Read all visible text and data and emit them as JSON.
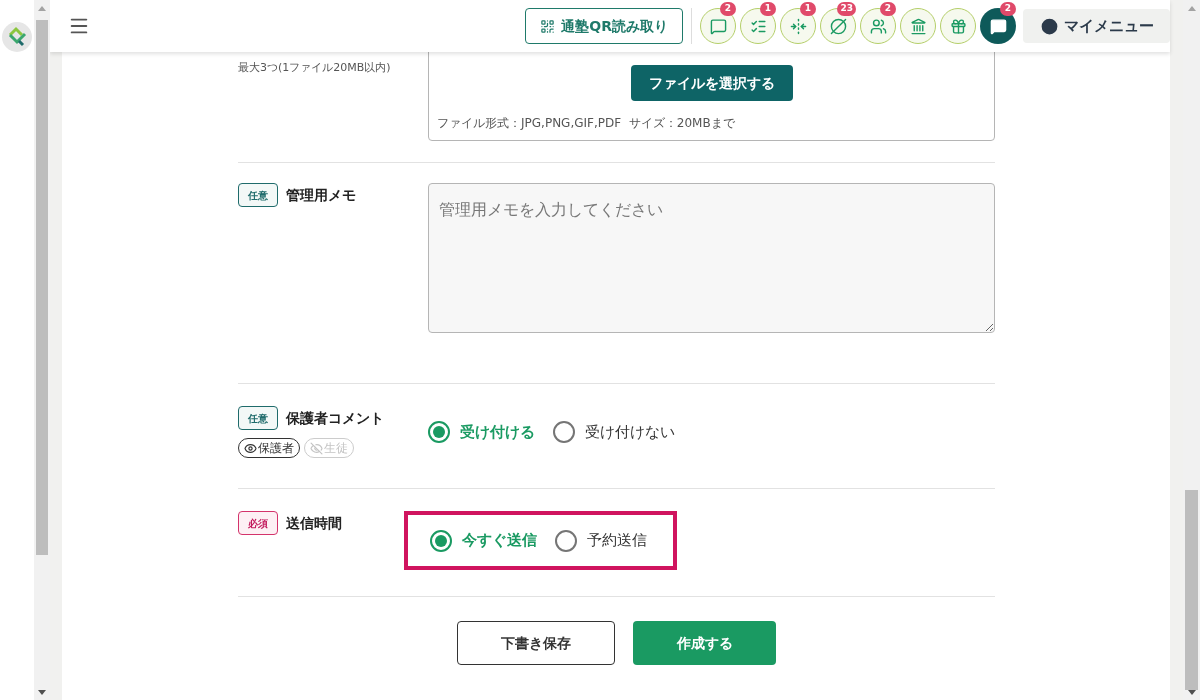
{
  "header": {
    "qr_button": "通塾QR読み取り",
    "icons": [
      {
        "kind": "chat",
        "badge": "2",
        "selected": false
      },
      {
        "kind": "checklist",
        "badge": "1",
        "selected": false
      },
      {
        "kind": "merge",
        "badge": "1",
        "selected": false
      },
      {
        "kind": "off",
        "badge": "23",
        "selected": false
      },
      {
        "kind": "group",
        "badge": "2",
        "selected": false
      },
      {
        "kind": "school",
        "selected": false
      },
      {
        "kind": "gift",
        "selected": false
      },
      {
        "kind": "chat",
        "badge": "2",
        "selected": true
      }
    ],
    "my_menu": "マイメニュー"
  },
  "attachment": {
    "note": "最大3つ(1ファイル20MB以内)",
    "button": "ファイルを選択する",
    "hint": "ファイル形式：JPG,PNG,GIF,PDF  サイズ：20MBまで"
  },
  "rows": [
    {
      "kind": "textarea",
      "badge": {
        "text": "任意",
        "required": false
      },
      "label": "管理用メモ",
      "placeholder": "管理用メモを入力してください"
    },
    {
      "kind": "radio",
      "badge": {
        "text": "任意",
        "required": false
      },
      "label": "保護者コメント",
      "audience": [
        {
          "text": "保護者",
          "visible": true
        },
        {
          "text": "生徒",
          "visible": false
        }
      ],
      "highlighted": false,
      "options": [
        {
          "label": "受け付ける",
          "selected": true
        },
        {
          "label": "受け付けない",
          "selected": false
        }
      ]
    },
    {
      "kind": "radio",
      "badge": {
        "text": "必須",
        "required": true
      },
      "label": "送信時間",
      "highlighted": true,
      "options": [
        {
          "label": "今すぐ送信",
          "selected": true
        },
        {
          "label": "予約送信",
          "selected": false
        }
      ]
    }
  ],
  "buttons": [
    {
      "label": "下書き保存",
      "kind": "secondary"
    },
    {
      "label": "作成する",
      "kind": "primary"
    }
  ]
}
